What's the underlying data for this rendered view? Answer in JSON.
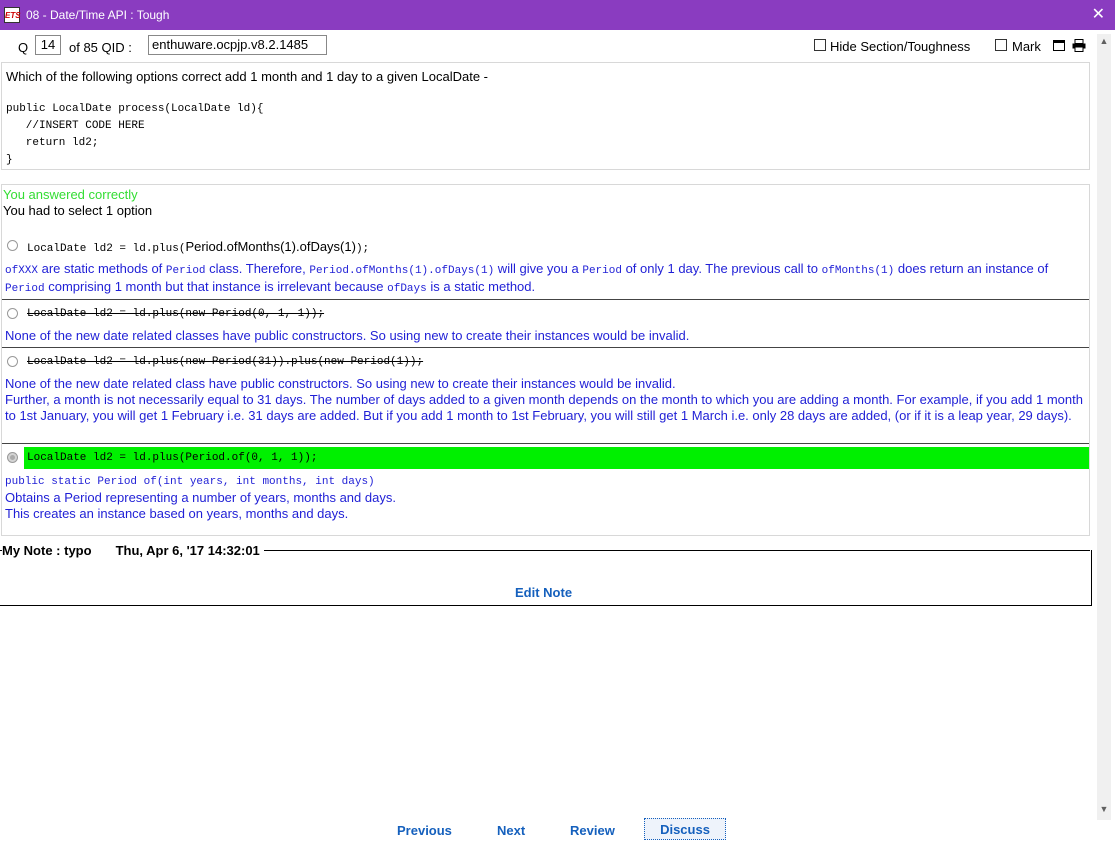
{
  "window": {
    "title": "08 - Date/Time API : Tough",
    "icon_text": "ETS",
    "close_glyph": "✕"
  },
  "toolbar": {
    "q_label": "Q",
    "q_value": "14",
    "of_label": "of 85 QID :",
    "qid_value": "enthuware.ocpjp.v8.2.1485",
    "hide_label": "Hide Section/Toughness",
    "mark_label": "Mark"
  },
  "question": {
    "text": "Which of the following options correct add 1 month and 1 day to a given LocalDate -",
    "code": "public LocalDate process(LocalDate ld){\n   //INSERT CODE HERE\n   return ld2;\n}"
  },
  "result": {
    "correct_msg": "You answered correctly",
    "select_msg": "You had to select 1 option"
  },
  "options": [
    {
      "code_a": "LocalDate ld2 = ld.plus(",
      "code_b": "Period.ofMonths(1).ofDays(1)",
      "code_c": ");",
      "explain_parts": [
        {
          "t": "ofXXX",
          "mono": true
        },
        {
          "t": " are static methods of ",
          "mono": false
        },
        {
          "t": "Period",
          "mono": true
        },
        {
          "t": " class. Therefore, ",
          "mono": false
        },
        {
          "t": "Period.ofMonths(1).ofDays(1)",
          "mono": true
        },
        {
          "t": "  will give you a ",
          "mono": false
        },
        {
          "t": "Period",
          "mono": true
        },
        {
          "t": " of only 1 day. The previous call to ",
          "mono": false
        },
        {
          "t": "ofMonths(1)",
          "mono": true
        },
        {
          "t": " does return an instance of ",
          "mono": false
        },
        {
          "t": "Period",
          "mono": true
        },
        {
          "t": " comprising 1 month but that instance is irrelevant because ",
          "mono": false
        },
        {
          "t": "ofDays",
          "mono": true
        },
        {
          "t": " is a static method.",
          "mono": false
        }
      ]
    },
    {
      "code": "LocalDate ld2 = ld.plus(new Period(0, 1, 1));",
      "explain": "None of the new date related classes have public constructors. So using new to create their instances would be invalid."
    },
    {
      "code": "LocalDate ld2 = ld.plus(new Period(31)).plus(new Period(1));",
      "explain_line1": "None of the new date related class have public constructors. So using new to create their instances would be invalid.",
      "explain_line2": "Further, a month is not necessarily equal to 31 days. The number of days added to a given month depends on the month to which you are adding a month. For example, if you add 1 month to 1st January, you will get 1 February i.e. 31 days are added. But if you add 1 month to 1st February, you will still get 1 March i.e. only 28 days are added, (or if it is a leap year, 29 days)."
    },
    {
      "code": "LocalDate ld2 = ld.plus(Period.of(0, 1, 1));",
      "explain_sig": "public static Period of(int years, int months, int days)",
      "explain_line1": "Obtains a Period representing a number of years, months and days.",
      "explain_line2": "This creates an instance based on years, months and days."
    }
  ],
  "note": {
    "header": "My Note : typo",
    "timestamp": "Thu, Apr 6, '17  14:32:01",
    "edit_label": "Edit Note"
  },
  "nav": {
    "previous": "Previous",
    "next": "Next",
    "review": "Review",
    "discuss": "Discuss"
  },
  "colors": {
    "titlebar": "#8a3cc0",
    "correct_green": "#33dd33",
    "selected_bar": "#00f000",
    "explain_blue": "#1f1fd6",
    "link_blue": "#1560bd"
  }
}
